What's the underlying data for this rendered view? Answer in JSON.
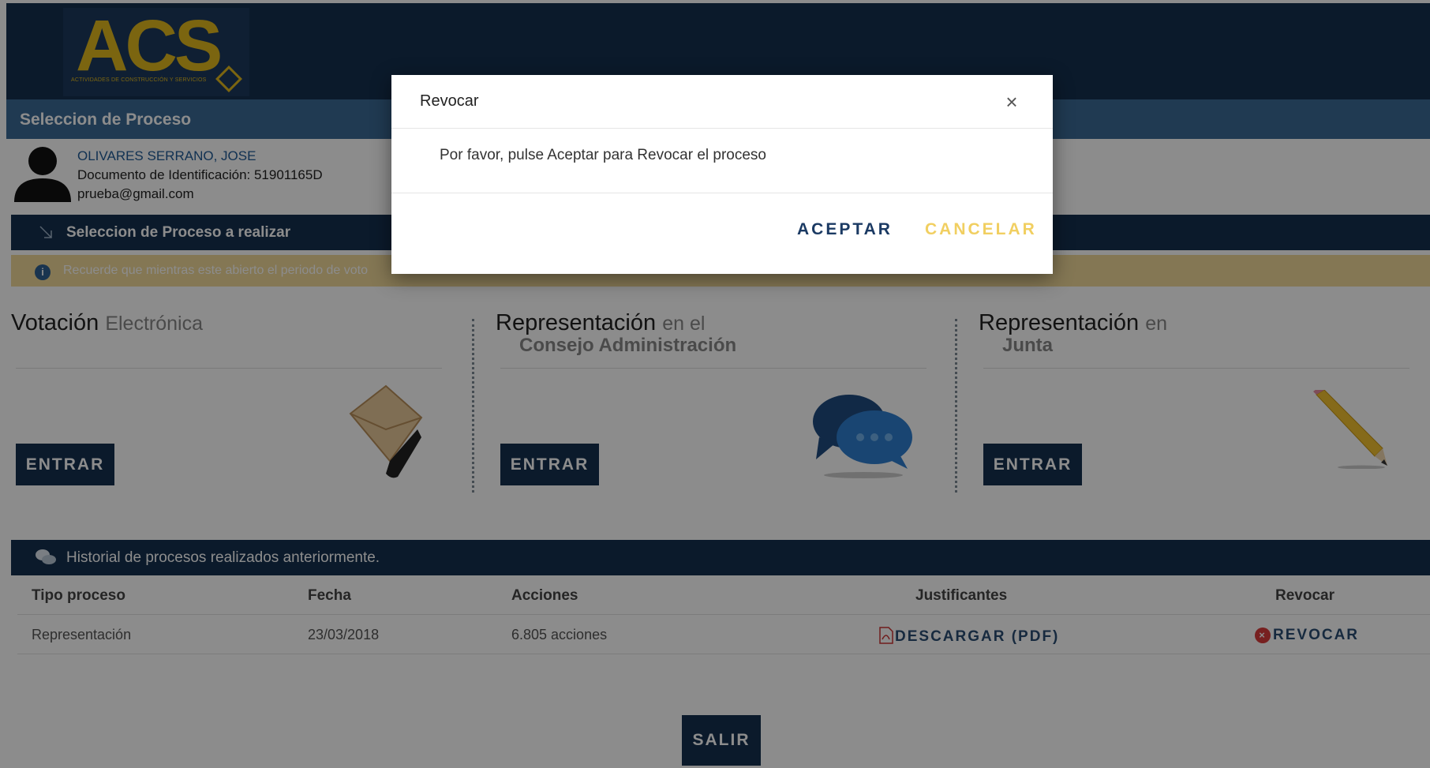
{
  "header": {
    "logo_text": "ACS",
    "logo_sub": "ACTIVIDADES DE CONSTRUCCIÓN Y SERVICIOS",
    "title": "Seleccion de Proceso"
  },
  "user": {
    "name": "OLIVARES SERRANO, JOSE",
    "document": "Documento de Identificación: 51901165D",
    "email": "prueba@gmail.com"
  },
  "selection": {
    "title": "Seleccion de Proceso a realizar",
    "info": "Recuerde que mientras este abierto el periodo de voto"
  },
  "cards": [
    {
      "title": "Votación",
      "sub": "Electrónica",
      "sub2": "",
      "button": "ENTRAR",
      "icon": "envelope-icon"
    },
    {
      "title": "Representación",
      "sub": "en el",
      "sub2": "Consejo Administración",
      "button": "ENTRAR",
      "icon": "chat-bubbles-icon"
    },
    {
      "title": "Representación",
      "sub": "en",
      "sub2": "Junta",
      "button": "ENTRAR",
      "icon": "pencil-icon"
    }
  ],
  "history": {
    "title": "Historial de procesos realizados anteriormente.",
    "columns": [
      "Tipo proceso",
      "Fecha",
      "Acciones",
      "Justificantes",
      "Revocar"
    ],
    "rows": [
      {
        "tipo": "Representación",
        "fecha": "23/03/2018",
        "acciones": "6.805 acciones",
        "justificante": "DESCARGAR (PDF)",
        "revocar": "REVOCAR"
      }
    ]
  },
  "salir": "SALIR",
  "modal": {
    "title": "Revocar",
    "close": "×",
    "message": "Por favor, pulse Aceptar para Revocar el proceso",
    "accept": "ACEPTAR",
    "cancel": "CANCELAR"
  },
  "colors": {
    "navy": "#15314f",
    "blue_bar": "#3b6a96",
    "gold": "#e1b81e",
    "info_bar": "#f0d99a",
    "cancel": "#f1cf61",
    "revoke_red": "#d93b3b"
  }
}
